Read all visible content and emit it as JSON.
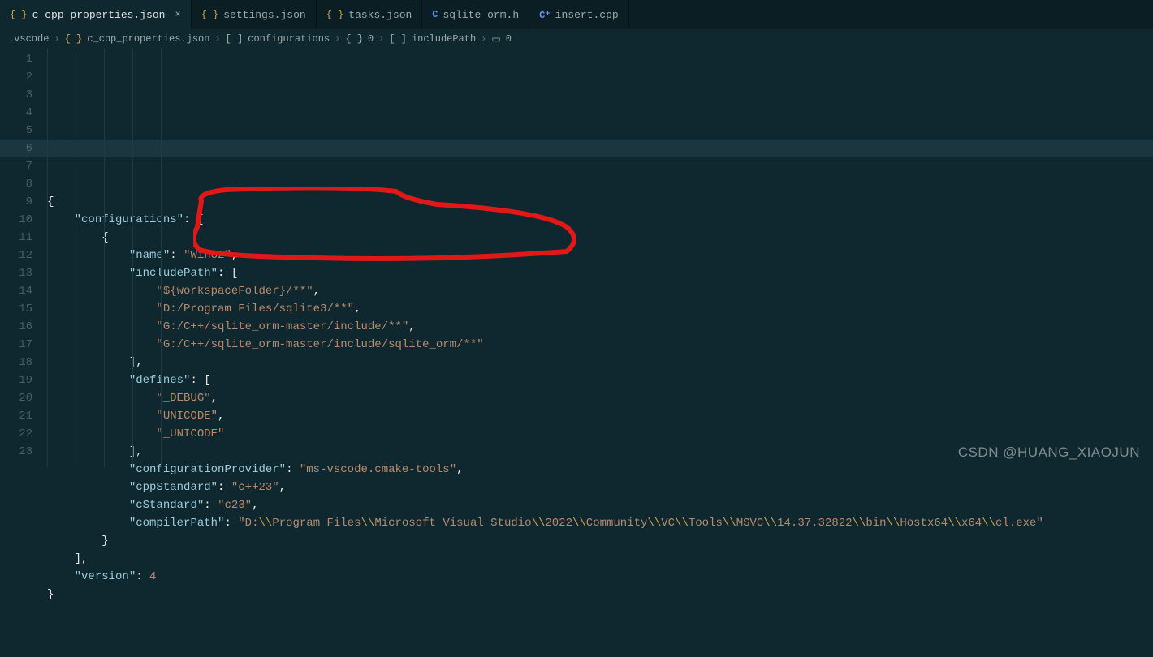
{
  "tabs": [
    {
      "label": "c_cpp_properties.json",
      "icon": "json",
      "active": true,
      "closeable": true
    },
    {
      "label": "settings.json",
      "icon": "json",
      "active": false
    },
    {
      "label": "tasks.json",
      "icon": "json",
      "active": false
    },
    {
      "label": "sqlite_orm.h",
      "icon": "c",
      "active": false
    },
    {
      "label": "insert.cpp",
      "icon": "cpp",
      "active": false
    }
  ],
  "breadcrumb": {
    "folder": ".vscode",
    "file": "c_cpp_properties.json",
    "path_parts": [
      "configurations",
      "0",
      "includePath",
      "0"
    ],
    "raw": ".vscode > {} c_cpp_properties.json > [ ] configurations > {} 0 > [ ] includePath > ▭ 0"
  },
  "file_content": {
    "configurations_key": "configurations",
    "name_key": "name",
    "name_val": "Win32",
    "includePath_key": "includePath",
    "includePaths": [
      "${workspaceFolder}/**",
      "D:/Program Files/sqlite3/**",
      "G:/C++/sqlite_orm-master/include/**",
      "G:/C++/sqlite_orm-master/include/sqlite_orm/**"
    ],
    "defines_key": "defines",
    "defines": [
      "_DEBUG",
      "UNICODE",
      "_UNICODE"
    ],
    "configurationProvider_key": "configurationProvider",
    "configurationProvider_val": "ms-vscode.cmake-tools",
    "cppStandard_key": "cppStandard",
    "cppStandard_val": "c++23",
    "cStandard_key": "cStandard",
    "cStandard_val": "c23",
    "compilerPath_key": "compilerPath",
    "compilerPath_val": "D:\\\\Program Files\\\\Microsoft Visual Studio\\\\2022\\\\Community\\\\VC\\\\Tools\\\\MSVC\\\\14.37.32822\\\\bin\\\\Hostx64\\\\x64\\\\cl.exe",
    "version_key": "version",
    "version_val": 4
  },
  "line_count": 23,
  "watermark": "CSDN @HUANG_XIAOJUN"
}
